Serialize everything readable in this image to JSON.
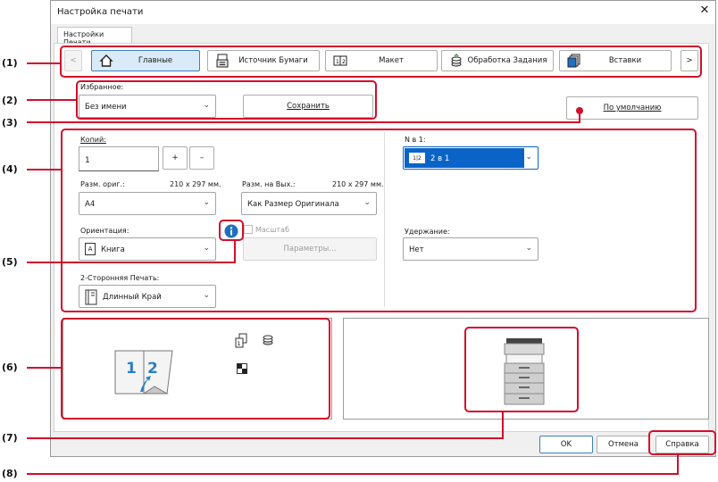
{
  "window": {
    "title": "Настройка печати",
    "close_glyph": "✕"
  },
  "tab": {
    "label": "Настройки Печати"
  },
  "nav": {
    "prev": "<",
    "next": ">",
    "items": [
      {
        "label": "Главные",
        "icon": "home-icon"
      },
      {
        "label": "Источник Бумаги",
        "icon": "paper-tray-icon"
      },
      {
        "label": "Макет",
        "icon": "layout-icon"
      },
      {
        "label": "Обработка Задания",
        "icon": "job-handling-icon"
      },
      {
        "label": "Вставки",
        "icon": "inserts-icon"
      }
    ]
  },
  "favorites": {
    "label": "Избранное:",
    "value": "Без имени",
    "save": "Сохранить",
    "defaults": "По умолчанию"
  },
  "copies": {
    "label": "Копий:",
    "value": "1",
    "plus": "+",
    "minus": "–"
  },
  "orig_size": {
    "label": "Разм. ориг.:",
    "dims": "210 x 297 мм.",
    "value": "A4"
  },
  "out_size": {
    "label": "Разм. на Вых.:",
    "dims": "210 x 297 мм.",
    "value": "Как Размер Оригинала"
  },
  "orientation": {
    "label": "Ориентация:",
    "value": "Книга",
    "icon_glyph": "A"
  },
  "scale": {
    "label": "Масштаб",
    "params": "Параметры..."
  },
  "duplex": {
    "label": "2-Сторонняя Печать:",
    "value": "Длинный Край"
  },
  "n_up": {
    "label": "N в 1:",
    "value": "2 в 1",
    "icon_text": "1|2"
  },
  "retention": {
    "label": "Удержание:",
    "value": "Нет"
  },
  "preview_page": {
    "left": "1",
    "right": "2"
  },
  "buttons": {
    "ok": "OK",
    "cancel": "Отмена",
    "help": "Справка"
  },
  "markers": [
    "(1)",
    "(2)",
    "(3)",
    "(4)",
    "(5)",
    "(6)",
    "(7)",
    "(8)"
  ],
  "colors": {
    "callout": "#d40e2b",
    "accent": "#3c7fc2",
    "selected_bg": "#0a64c8"
  }
}
